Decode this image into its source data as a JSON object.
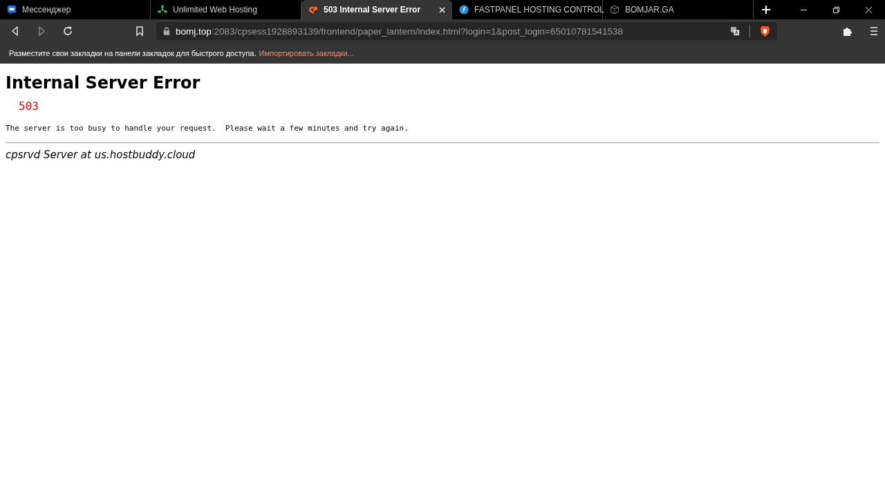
{
  "tabs": [
    {
      "label": "Мессенджер",
      "kind": "chat",
      "selected": false
    },
    {
      "label": "Unlimited Web Hosting",
      "kind": "leaf",
      "selected": false
    },
    {
      "label": "503 Internal Server Error",
      "kind": "cpanel",
      "selected": true
    },
    {
      "label": "FASTPANEL HOSTING CONTROL",
      "kind": "fastpanel",
      "selected": false
    },
    {
      "label": "BOMJAR.GA",
      "kind": "cube",
      "selected": false
    }
  ],
  "address": {
    "host": "bomj.top",
    "rest": ":2083/cpsess1928893139/frontend/paper_lantern/index.html?login=1&post_login=65010781541538"
  },
  "bookmarks_bar": {
    "message": "Разместите свои закладки на панели закладок для быстрого доступа.",
    "link": "Импортировать закладки..."
  },
  "page": {
    "heading": "Internal Server Error",
    "code": "503",
    "message": "The server is too busy to handle your request.  Please wait a few minutes and try again.",
    "footer": "cpsrvd Server at us.hostbuddy.cloud"
  }
}
